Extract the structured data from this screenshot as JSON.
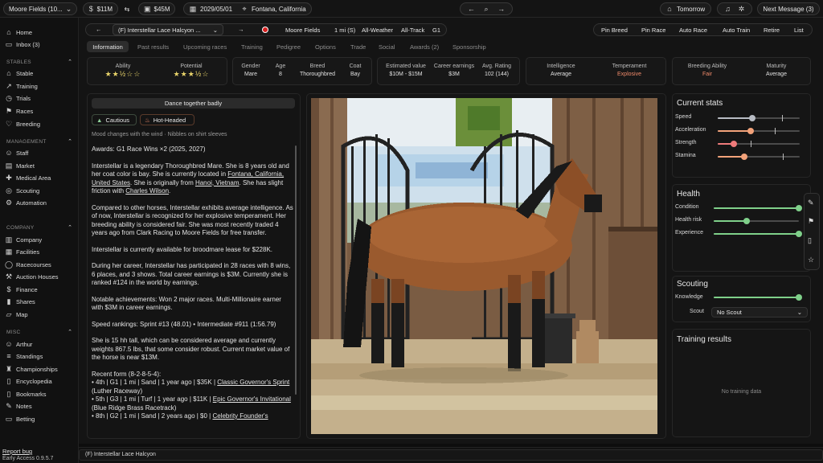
{
  "topbar": {
    "stable_name": "Moore Fields (10...",
    "money": "$11M",
    "assets": "$45M",
    "date": "2029/05/01",
    "location": "Fontana, California",
    "tomorrow_label": "Tomorrow",
    "next_message_label": "Next Message (3)"
  },
  "horse_bar": {
    "horse_name": "(F) Interstellar Lace Halcyon ...",
    "stable": "Moore Fields",
    "distance": "1 mi (S)",
    "weather": "All-Weather",
    "track": "All-Track",
    "grade": "G1",
    "actions": [
      "Pin Breed",
      "Pin Race",
      "Auto Race",
      "Auto Train",
      "Retire",
      "List"
    ]
  },
  "tabs": [
    "Information",
    "Past results",
    "Upcoming races",
    "Training",
    "Pedigree",
    "Options",
    "Trade",
    "Social",
    "Awards (2)",
    "Sponsorship"
  ],
  "sidebar": {
    "top": [
      "Home",
      "Inbox (3)"
    ],
    "stables_title": "STABLES",
    "stables": [
      "Stable",
      "Training",
      "Trials",
      "Races",
      "Breeding"
    ],
    "management_title": "MANAGEMENT",
    "management": [
      "Staff",
      "Market",
      "Medical Area",
      "Scouting",
      "Automation"
    ],
    "company_title": "COMPANY",
    "company": [
      "Company",
      "Facilities",
      "Racecourses",
      "Auction Houses",
      "Finance",
      "Shares",
      "Map"
    ],
    "misc_title": "MISC",
    "misc": [
      "Arthur",
      "Standings",
      "Championships",
      "Encyclopedia",
      "Bookmarks",
      "Notes",
      "Betting"
    ],
    "report_bug": "Report bug",
    "version": "Early Access 0.9.5.7"
  },
  "stats": {
    "ability_label": "Ability",
    "ability_stars": "★★½☆☆",
    "ability_rating": 2.5,
    "potential_label": "Potential",
    "potential_stars": "★★★½☆",
    "potential_rating": 3.5,
    "gender_label": "Gender",
    "gender": "Mare",
    "age_label": "Age",
    "age": "8",
    "breed_label": "Breed",
    "breed": "Thoroughbred",
    "coat_label": "Coat",
    "coat": "Bay",
    "est_label": "Estimated value",
    "est": "$10M - $15M",
    "earn_label": "Career earnings",
    "earn": "$3M",
    "rating_label": "Avg. Rating",
    "rating": "102 (144)",
    "intel_label": "Intelligence",
    "intel": "Average",
    "temper_label": "Temperament",
    "temper": "Explosive",
    "breedab_label": "Breeding Ability",
    "breedab": "Fair",
    "maturity_label": "Maturity",
    "maturity": "Average"
  },
  "traits": {
    "banner": "Dance together badly",
    "cautious": "Cautious",
    "hotheaded": "Hot-Headed",
    "mood": "Mood changes with the wind",
    "habit": "Nibbles on shirt sleeves"
  },
  "bio": {
    "awards": "Awards: G1 Race Wins ×2 (2025, 2027)",
    "p1_a": "Interstellar is a legendary Thoroughbred Mare. She is 8 years old and her coat color is bay. She is currently located in ",
    "p1_loc": "Fontana, California, United States",
    "p1_b": ". She is originally from ",
    "p1_origin": "Hanoi, Vietnam",
    "p1_c": ". She has slight friction with ",
    "p1_person": "Charles Wilson",
    "p1_d": ".",
    "p2": "Compared to other horses, Interstellar exhibits average intelligence. As of now, Interstellar is recognized for her explosive temperament. Her breeding ability is considered fair. She was most recently traded 4 years ago from Clark Racing to Moore Fields for free transfer.",
    "p3": "Interstellar is currently available for broodmare lease for $228K.",
    "p4": "During her career, Interstellar has participated in 28 races with 8 wins, 6 places, and 3 shows. Total career earnings is $3M. Currently she is ranked #124 in the world by earnings.",
    "p5": "Notable achievements: Won 2 major races. Multi-Millionaire earner with $3M in career earnings.",
    "p6": "Speed rankings: Sprint #13 (48.01) • Intermediate #911 (1:56.79)",
    "p7": "She is 15 hh tall, which can be considered average and currently weights 867.5 lbs, that some consider robust. Current market value of the horse is near $13M.",
    "form_title": "Recent form (8-2-8-5-4):",
    "f1_a": "• 4th | G1 | 1 mi | Sand | 1 year ago | $35K | ",
    "f1_race": "Classic Governor's Sprint",
    "f1_b": " (Luther Raceway)",
    "f2_a": "• 5th | G3 | 1 mi | Turf | 1 year ago | $11K | ",
    "f2_race": "Epic Governor's Invitational",
    "f2_b": " (Blue Ridge Brass Racetrack)",
    "f3_a": "• 8th | G2 | 1 mi | Sand | 2 years ago | $0 | ",
    "f3_race": "Celebrity Founder's"
  },
  "current_stats": {
    "title": "Current stats",
    "items": [
      {
        "label": "Speed",
        "value": 0.42,
        "potential": 0.78,
        "color": "#b8bcc4"
      },
      {
        "label": "Acceleration",
        "value": 0.4,
        "potential": 0.7,
        "color": "#f2a27a"
      },
      {
        "label": "Strength",
        "value": 0.2,
        "potential": 0.4,
        "color": "#ef7b7b"
      },
      {
        "label": "Stamina",
        "value": 0.32,
        "potential": 0.79,
        "color": "#f2a27a"
      }
    ]
  },
  "health": {
    "title": "Health",
    "items": [
      {
        "label": "Condition",
        "value": 1.0
      },
      {
        "label": "Health risk",
        "value": 0.39
      },
      {
        "label": "Experience",
        "value": 1.0
      }
    ],
    "color": "#7fd08a"
  },
  "scouting": {
    "title": "Scouting",
    "knowledge_label": "Knowledge",
    "knowledge_value": 1.0,
    "scout_label": "Scout",
    "scout_value": "No Scout"
  },
  "training_results": {
    "title": "Training results",
    "empty": "No training data"
  },
  "statusbar": {
    "horse": "(F) Interstellar Lace Halcyon"
  }
}
